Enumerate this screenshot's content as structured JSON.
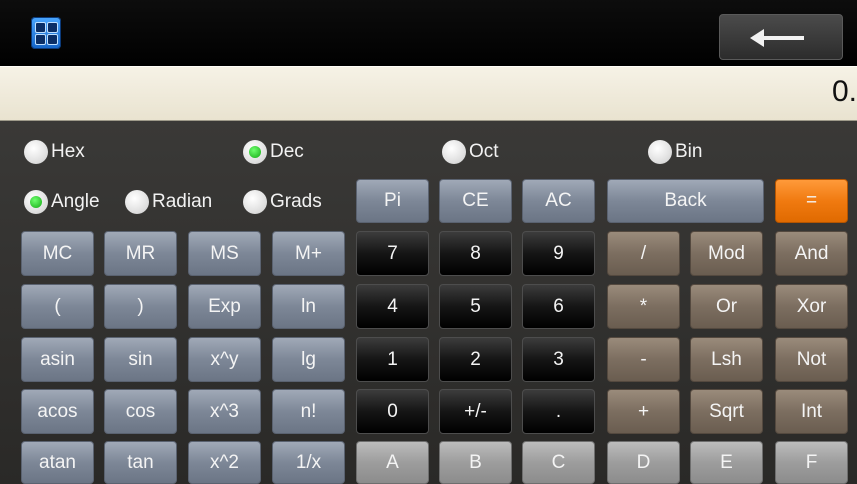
{
  "title_bar": {
    "back_icon": "left-arrow-icon",
    "app_icon": "calculator-grid-icon"
  },
  "display": {
    "value": "0."
  },
  "radix": {
    "hex": "Hex",
    "dec": "Dec",
    "oct": "Oct",
    "bin": "Bin",
    "selected": "Dec"
  },
  "angle_units": {
    "angle": "Angle",
    "radian": "Radian",
    "grads": "Grads",
    "selected": "Angle"
  },
  "keys": {
    "pi": "Pi",
    "ce": "CE",
    "ac": "AC",
    "back": "Back",
    "equals": "=",
    "mc": "MC",
    "mr": "MR",
    "ms": "MS",
    "mplus": "M+",
    "n7": "7",
    "n8": "8",
    "n9": "9",
    "divide": "/",
    "mod": "Mod",
    "and": "And",
    "lparen": "(",
    "rparen": ")",
    "exp": "Exp",
    "ln": "ln",
    "n4": "4",
    "n5": "5",
    "n6": "6",
    "multiply": "*",
    "or": "Or",
    "xor": "Xor",
    "asin": "asin",
    "sin": "sin",
    "xpowy": "x^y",
    "lg": "lg",
    "n1": "1",
    "n2": "2",
    "n3": "3",
    "minus": "-",
    "lsh": "Lsh",
    "not": "Not",
    "acos": "acos",
    "cos": "cos",
    "xcube": "x^3",
    "fact": "n!",
    "n0": "0",
    "negate": "+/-",
    "dot": ".",
    "plus": "+",
    "sqrt": "Sqrt",
    "int": "Int",
    "atan": "atan",
    "tan": "tan",
    "xsq": "x^2",
    "recip": "1/x",
    "hexA": "A",
    "hexB": "B",
    "hexC": "C",
    "hexD": "D",
    "hexE": "E",
    "hexF": "F"
  },
  "colors": {
    "accent_equals": "#f07a10",
    "display_bg": "#f2eee0",
    "radio_selected": "#12a812"
  }
}
